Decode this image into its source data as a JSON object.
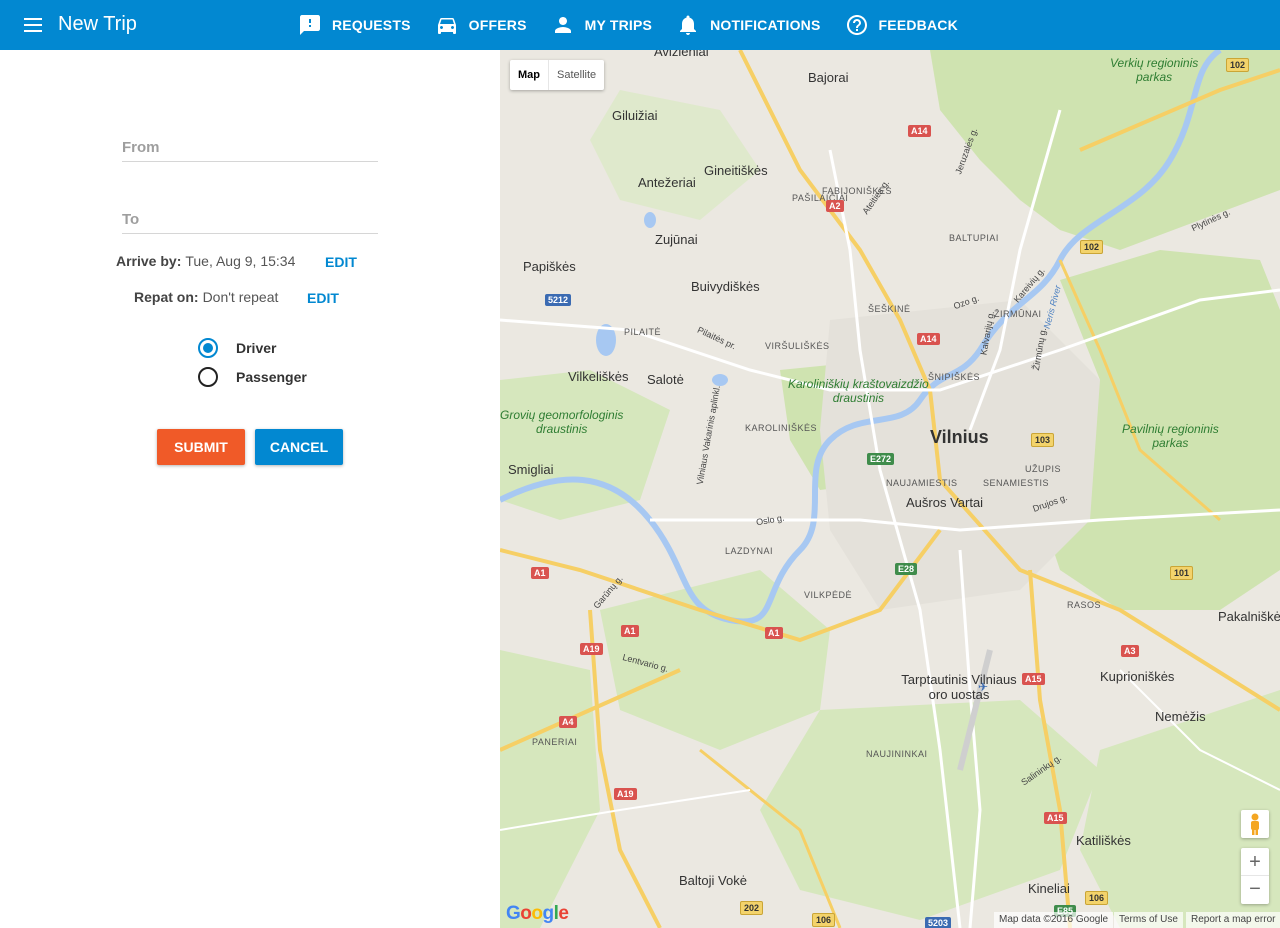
{
  "app": {
    "title": "New Trip"
  },
  "nav": [
    {
      "icon": "feedback-exclamation-icon",
      "label": "REQUESTS"
    },
    {
      "icon": "car-icon",
      "label": "OFFERS"
    },
    {
      "icon": "person-icon",
      "label": "MY TRIPS"
    },
    {
      "icon": "bell-icon",
      "label": "NOTIFICATIONS"
    },
    {
      "icon": "help-circle-icon",
      "label": "FEEDBACK"
    }
  ],
  "form": {
    "from_placeholder": "From",
    "from_value": "",
    "to_placeholder": "To",
    "to_value": "",
    "arrive_label": "Arrive by:",
    "arrive_value": "Tue, Aug 9, 15:34",
    "arrive_edit": "EDIT",
    "repeat_label": "Repat on:",
    "repeat_value": "Don't repeat",
    "repeat_edit": "EDIT",
    "role_options": [
      "Driver",
      "Passenger"
    ],
    "role_selected": "Driver",
    "submit_label": "SUBMIT",
    "cancel_label": "CANCEL"
  },
  "colors": {
    "appbar": "#0288d1",
    "accent": "#0288d1",
    "submit": "#f05a28",
    "cancel": "#0288d1"
  },
  "map": {
    "type_options": [
      "Map",
      "Satellite"
    ],
    "type_selected": "Map",
    "city": "Vilnius",
    "places": [
      "Avižieniai",
      "Bajorai",
      "Giluižiai",
      "Gineitiškės",
      "Antežeriai",
      "Zujūnai",
      "Papiškės",
      "Buivydiškės",
      "Vilkeliškės",
      "Salotė",
      "Smigliai",
      "Tarptautinis Vilniaus oro uostas",
      "Aušros Vartai",
      "Kuprioniškės",
      "Pakalniškės",
      "Nemėžis",
      "Katiliškės",
      "Kineliai",
      "Baltoji Vokė"
    ],
    "districts": [
      "FABIJONIŠKĖS",
      "PAŠILAIČIAI",
      "BALTUPIAI",
      "ŠEŠKINĖ",
      "ŽIRMŪNAI",
      "PILAITĖ",
      "VIRŠULIŠKĖS",
      "ŠNIPIŠKĖS",
      "KAROLINIŠKĖS",
      "NAUJAMIESTIS",
      "SENAMIESTIS",
      "UŽUPIS",
      "LAZDYNAI",
      "VILKPĖDĖ",
      "RASOS",
      "PANERIAI",
      "NAUJININKAI"
    ],
    "parks": [
      "Verkių regioninis parkas",
      "Pavilnių regioninis parkas",
      "Karoliniškių kraštovaizdžio draustinis",
      "Grovių geomorfologinis draustinis"
    ],
    "streets": [
      "Ateities g.",
      "Jeruzalės g.",
      "Ozo g.",
      "Kareivių g.",
      "Žirmūnų g.",
      "Kalvarijų g.",
      "Pilaitės pr.",
      "Vilniaus Vakarinis aplinkl.",
      "Oslo g.",
      "Drujos g.",
      "Lentvario g.",
      "Garūnų g.",
      "Salininkų g.",
      "Plytinės g.",
      "Neris River"
    ],
    "road_codes": [
      "A14",
      "A2",
      "102",
      "5212",
      "A14",
      "102",
      "103",
      "E272",
      "E28",
      "A1",
      "A1",
      "A1",
      "A19",
      "A4",
      "A19",
      "101",
      "A3",
      "A15",
      "A15",
      "106",
      "202",
      "106",
      "5203",
      "E85"
    ],
    "zoom_in": "+",
    "zoom_out": "−",
    "logo": "Google",
    "attribution": "Map data ©2016 Google",
    "terms": "Terms of Use",
    "report": "Report a map error"
  }
}
